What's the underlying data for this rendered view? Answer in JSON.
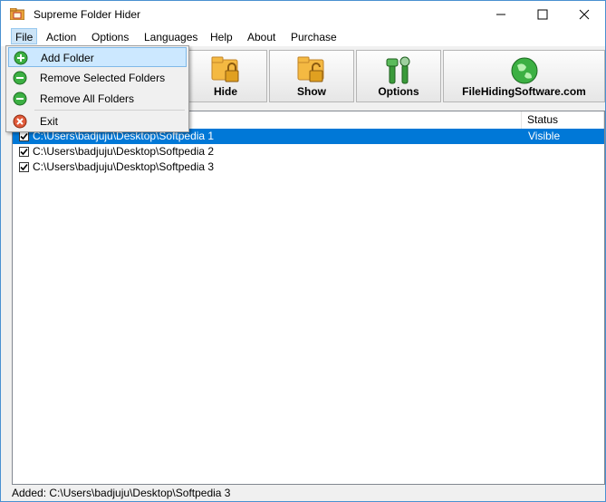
{
  "window": {
    "title": "Supreme Folder Hider"
  },
  "menubar": {
    "items": [
      {
        "label": "File"
      },
      {
        "label": "Action"
      },
      {
        "label": "Options"
      },
      {
        "label": "Languages"
      },
      {
        "label": "Help"
      },
      {
        "label": "About"
      },
      {
        "label": "Purchase"
      }
    ]
  },
  "file_menu": {
    "items": [
      {
        "label": "Add Folder",
        "icon": "green-plus-icon"
      },
      {
        "label": "Remove Selected Folders",
        "icon": "green-minus-icon"
      },
      {
        "label": "Remove All Folders",
        "icon": "green-minus-icon"
      },
      {
        "label": "Exit",
        "icon": "red-exit-icon"
      }
    ]
  },
  "toolbar": {
    "buttons": [
      {
        "label": "Hide",
        "icon": "folder-lock-icon"
      },
      {
        "label": "Show",
        "icon": "folder-unlock-icon"
      },
      {
        "label": "Options",
        "icon": "tools-icon"
      },
      {
        "label": "FileHidingSoftware.com",
        "icon": "globe-icon"
      }
    ]
  },
  "list": {
    "columns": [
      {
        "label": ""
      },
      {
        "label": "Status"
      }
    ],
    "rows": [
      {
        "path": "C:\\Users\\badjuju\\Desktop\\Softpedia 1",
        "status": "Visible",
        "checked": true,
        "selected": true
      },
      {
        "path": "C:\\Users\\badjuju\\Desktop\\Softpedia 2",
        "status": "",
        "checked": true,
        "selected": false
      },
      {
        "path": "C:\\Users\\badjuju\\Desktop\\Softpedia 3",
        "status": "",
        "checked": true,
        "selected": false
      }
    ]
  },
  "statusbar": {
    "text": "Added: C:\\Users\\badjuju\\Desktop\\Softpedia 3"
  },
  "colors": {
    "selection": "#0078d7",
    "menu_highlight": "#cce8ff",
    "green": "#3cb043"
  }
}
